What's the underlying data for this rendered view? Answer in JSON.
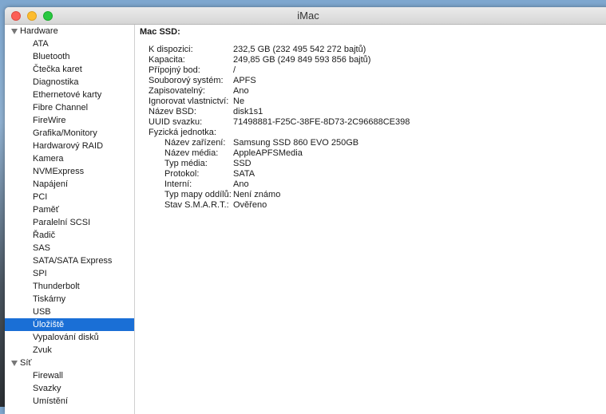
{
  "window": {
    "title": "iMac"
  },
  "sidebar": {
    "groups": [
      {
        "label": "Hardware",
        "items": [
          "ATA",
          "Bluetooth",
          "Čtečka karet",
          "Diagnostika",
          "Ethernetové karty",
          "Fibre Channel",
          "FireWire",
          "Grafika/Monitory",
          "Hardwarový RAID",
          "Kamera",
          "NVMExpress",
          "Napájení",
          "PCI",
          "Paměť",
          "Paralelní SCSI",
          "Řadič",
          "SAS",
          "SATA/SATA Express",
          "SPI",
          "Thunderbolt",
          "Tiskárny",
          "USB",
          "Úložiště",
          "Vypalování disků",
          "Zvuk"
        ]
      },
      {
        "label": "Síť",
        "items": [
          "Firewall",
          "Svazky",
          "Umístění"
        ]
      }
    ],
    "selected": "Úložiště"
  },
  "detail": {
    "title": "Mac SSD:",
    "fields": [
      {
        "k": "K dispozici:",
        "v": "232,5 GB (232 495 542 272 bajtů)"
      },
      {
        "k": "Kapacita:",
        "v": "249,85 GB (249 849 593 856 bajtů)"
      },
      {
        "k": "Přípojný bod:",
        "v": "/"
      },
      {
        "k": "Souborový systém:",
        "v": "APFS"
      },
      {
        "k": "Zapisovatelný:",
        "v": "Ano"
      },
      {
        "k": "Ignorovat vlastnictví:",
        "v": "Ne"
      },
      {
        "k": "Název BSD:",
        "v": "disk1s1"
      },
      {
        "k": "UUID svazku:",
        "v": "71498881-F25C-38FE-8D73-2C96688CE398"
      },
      {
        "k": "Fyzická jednotka:",
        "v": ""
      }
    ],
    "physical": [
      {
        "k": "Název zařízení:",
        "v": "Samsung SSD 860 EVO 250GB"
      },
      {
        "k": "Název média:",
        "v": "AppleAPFSMedia"
      },
      {
        "k": "Typ média:",
        "v": "SSD"
      },
      {
        "k": "Protokol:",
        "v": "SATA"
      },
      {
        "k": "Interní:",
        "v": "Ano"
      },
      {
        "k": "Typ mapy oddílů:",
        "v": "Není známo"
      },
      {
        "k": "Stav S.M.A.R.T.:",
        "v": "Ověřeno"
      }
    ]
  }
}
